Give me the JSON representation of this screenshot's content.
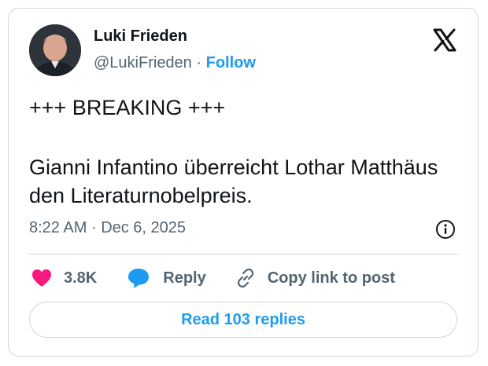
{
  "author": {
    "name": "Luki Frieden",
    "handle": "@LukiFrieden",
    "separator": "·",
    "follow_label": "Follow"
  },
  "tweet": {
    "line1": "+++ BREAKING +++",
    "line2": "Gianni Infantino überreicht Lothar Matthäus den Literaturnobelpreis.",
    "time": "8:22 AM",
    "date_separator": "·",
    "date": "Dec 6, 2025"
  },
  "actions": {
    "likes": "3.8K",
    "reply_label": "Reply",
    "copy_label": "Copy link to post"
  },
  "read_replies_label": "Read 103 replies",
  "icons": [
    "x-logo-icon",
    "info-icon",
    "heart-icon",
    "reply-bubble-icon",
    "link-icon"
  ],
  "colors": {
    "accent": "#1d9bf0",
    "like": "#f91880",
    "text": "#0f1419",
    "muted": "#536471",
    "border": "#cfd9de"
  }
}
